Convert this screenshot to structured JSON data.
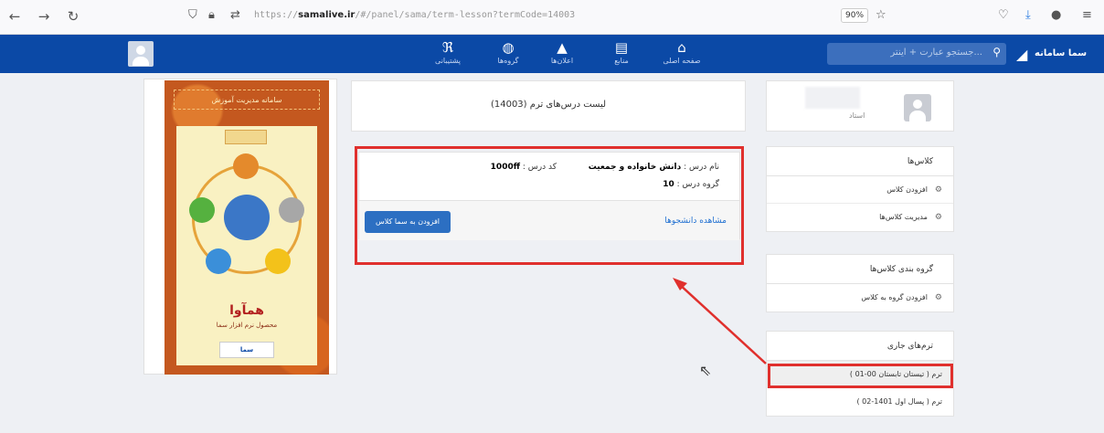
{
  "browser": {
    "url_prefix": "https://",
    "url_host": "samalive.ir",
    "url_path": "/#/panel/sama/term-lesson?termCode=14003",
    "zoom": "90%"
  },
  "navbar": {
    "brand": "سما سامانه",
    "search_placeholder": "جستجو عبارت + اینتر...",
    "items": [
      {
        "label": "پشتیبانی",
        "icon": "rss-icon"
      },
      {
        "label": "گروه‌ها",
        "icon": "globe-icon"
      },
      {
        "label": "اعلان‌ها",
        "icon": "bell-icon"
      },
      {
        "label": "منابع",
        "icon": "book-icon"
      },
      {
        "label": "صفحه اصلی",
        "icon": "home-icon"
      }
    ]
  },
  "profile": {
    "role": "استاد"
  },
  "classes_card": {
    "header": "کلاس‌ها",
    "items": [
      "افزودن کلاس",
      "مدیریت کلاس‌ها"
    ]
  },
  "grouping_card": {
    "header": "گروه بندی کلاس‌ها",
    "items": [
      "افزودن گروه به کلاس"
    ]
  },
  "terms_card": {
    "header": "ترم‌های جاری",
    "items": [
      "ترم ( تیستان تابستان 00-01 )",
      "ترم ( پسال اول 1401-02 )"
    ],
    "selected_index": 0
  },
  "main": {
    "title": "لیست درس‌های ترم (14003)",
    "lesson": {
      "name_label": "نام درس :",
      "name_value": "دانش خانواده و جمعیت",
      "code_label": "کد درس :",
      "code_value": "1000ff",
      "group_label": "گروه درس :",
      "group_value": "10",
      "view_students": "مشاهده دانشجوها",
      "add_to_sama": "افزودن به سما کلاس"
    }
  },
  "poster": {
    "title": "سامانه مدیریت آموزش",
    "brand": "همآوا",
    "subtitle": "محصول نرم افزار سما",
    "logo": "سما"
  },
  "colors": {
    "navbar": "#0b49a6",
    "highlight": "#e0302d",
    "button": "#2c6fc2"
  }
}
